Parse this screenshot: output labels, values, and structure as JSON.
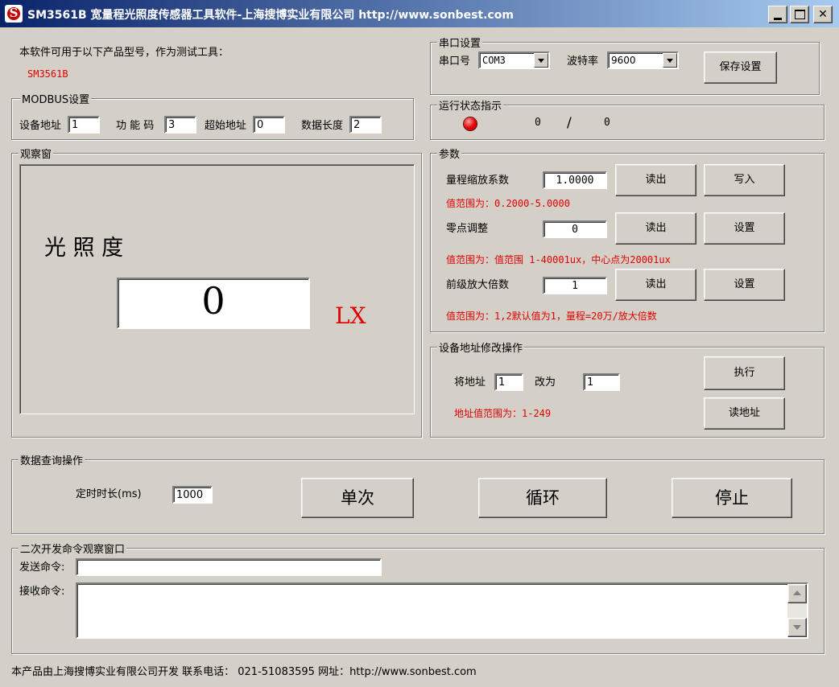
{
  "window": {
    "title": "SM3561B 宽量程光照度传感器工具软件-上海搜博实业有限公司 http://www.sonbest.com",
    "logo_letter": "S"
  },
  "intro": {
    "text": "本软件可用于以下产品型号，作为测试工具：",
    "model": "SM3561B"
  },
  "modbus": {
    "legend": "MODBUS设置",
    "device_addr_label": "设备地址",
    "device_addr": "1",
    "func_code_label": "功 能 码",
    "func_code": "3",
    "start_addr_label": "超始地址",
    "start_addr": "0",
    "data_len_label": "数据长度",
    "data_len": "2"
  },
  "observe": {
    "legend": "观察窗",
    "heading": "光 照 度",
    "value": "0",
    "unit": "LX"
  },
  "serial": {
    "legend": "串口设置",
    "port_label": "串口号",
    "port": "COM3",
    "baud_label": "波特率",
    "baud": "9600",
    "save_label": "保存设置"
  },
  "status": {
    "legend": "运行状态指示",
    "count_left": "0",
    "separator": "/",
    "count_right": "0",
    "led_color": "#e00000"
  },
  "params": {
    "legend": "参数",
    "scale_label": "量程缩放系数",
    "scale_value": "1.0000",
    "scale_range": "值范围为：0.2000-5.0000",
    "zero_label": "零点调整",
    "zero_value": "0",
    "zero_range": "值范围为：值范围 1-40001ux，中心点为20001ux",
    "gain_label": "前级放大倍数",
    "gain_value": "1",
    "gain_range": "值范围为：1,2默认值为1，量程=20万/放大倍数",
    "read_label": "读出",
    "write_label": "写入",
    "set_label": "设置"
  },
  "address": {
    "legend": "设备地址修改操作",
    "from_label": "将地址",
    "from_value": "1",
    "to_label": "改为",
    "to_value": "1",
    "range": "地址值范围为：1-249",
    "exec_label": "执行",
    "read_addr_label": "读地址"
  },
  "query": {
    "legend": "数据查询操作",
    "interval_label": "定时时长(ms)",
    "interval_value": "1000",
    "single_label": "单次",
    "loop_label": "循环",
    "stop_label": "停止"
  },
  "dev": {
    "legend": "二次开发命令观察窗口",
    "send_label": "发送命令:",
    "send_value": "",
    "recv_label": "接收命令:",
    "recv_value": ""
  },
  "footer": {
    "text": "本产品由上海搜博实业有限公司开发 联系电话： 021-51083595 网址：http://www.sonbest.com"
  }
}
